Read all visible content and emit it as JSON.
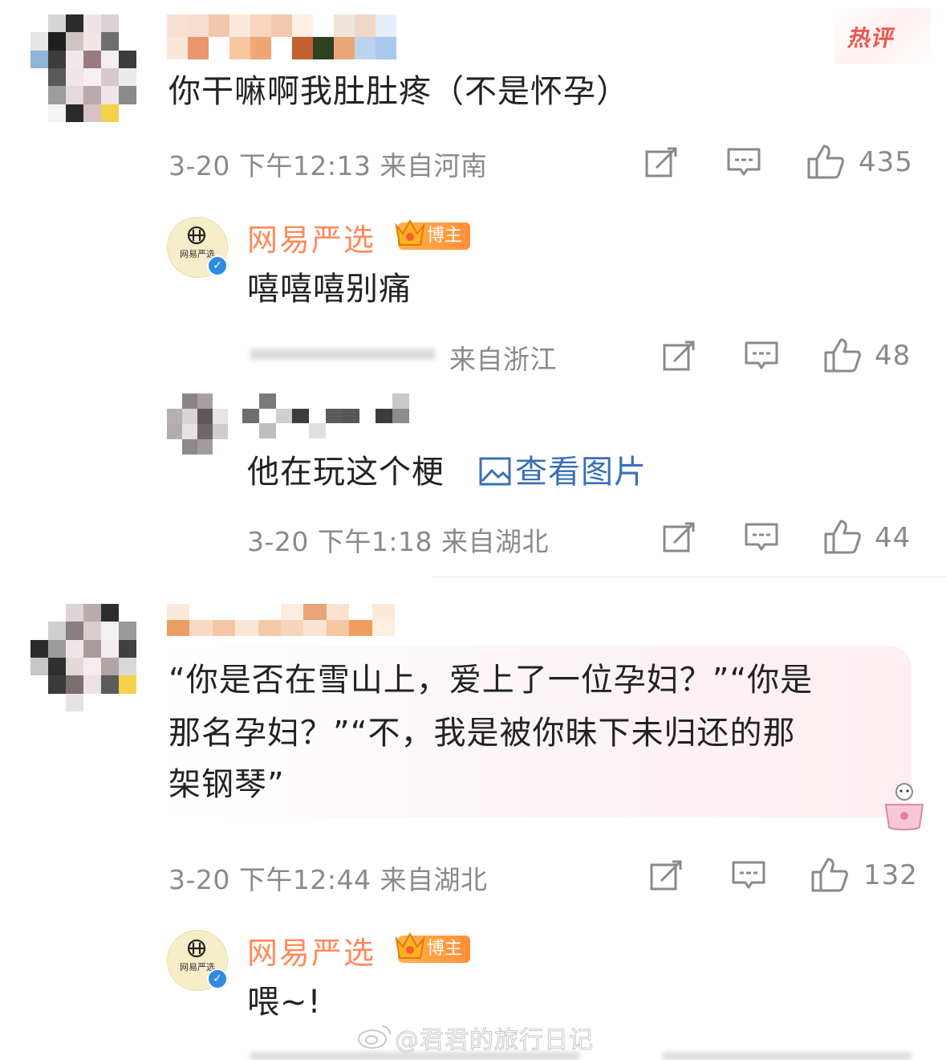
{
  "hot_label": "热评",
  "comments": [
    {
      "text": "你干嘛啊我肚肚疼（不是怀孕）",
      "meta": "3-20 下午12:13 来自河南",
      "likes": "435"
    },
    {
      "brand": "网易严选",
      "badge": "博主",
      "avatar_text": "网易严选",
      "text": "嘻嘻嘻别痛",
      "meta": "来自浙江",
      "likes": "48"
    },
    {
      "text": "他在玩这个梗",
      "link": "查看图片",
      "meta": "3-20 下午1:18 来自湖北",
      "likes": "44"
    },
    {
      "text_lines": [
        "“你是否在雪山上，爱上了一位孕妇？”“你是",
        "那名孕妇？”“不，我是被你昧下未归还的那",
        "架钢琴”"
      ],
      "meta": "3-20 下午12:44 来自湖北",
      "likes": "132"
    },
    {
      "brand": "网易严选",
      "badge": "博主",
      "avatar_text": "网易严选",
      "text": "喂~!"
    }
  ],
  "watermark": "@君君的旅行日记",
  "colors": {
    "brand": "#ff8a5b",
    "link": "#3a6fb5",
    "meta": "#8a8a8a",
    "hot": "#e8574f",
    "verified": "#2f8be0"
  },
  "icons": [
    "share-icon",
    "comment-icon",
    "thumbs-up-icon",
    "image-icon",
    "crown-icon",
    "verified-icon",
    "weibo-logo-icon"
  ]
}
